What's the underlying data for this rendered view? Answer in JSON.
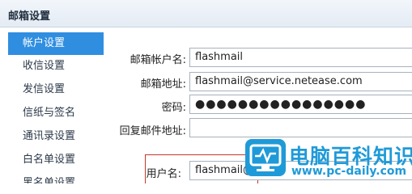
{
  "title": "邮箱设置",
  "sidebar": {
    "items": [
      {
        "label": "帐户设置"
      },
      {
        "label": "收信设置"
      },
      {
        "label": "发信设置"
      },
      {
        "label": "信纸与签名"
      },
      {
        "label": "通讯录设置"
      },
      {
        "label": "白名单设置"
      },
      {
        "label": "黑名单设置"
      }
    ]
  },
  "form": {
    "account_name": {
      "label": "邮箱帐户名:",
      "value": "flashmail"
    },
    "email_address": {
      "label": "邮箱地址:",
      "value": "flashmail@service.netease.com"
    },
    "password": {
      "label": "密码:",
      "value": "●●●●●●●●●●●●●●●●"
    },
    "reply_to": {
      "label": "回复邮件地址:",
      "value": ""
    },
    "username": {
      "label": "用户名:",
      "value": "flashmail@"
    }
  },
  "watermark": {
    "text": "电脑百科知识",
    "url": "www.pc-daily.com",
    "icon": "monitor-icon"
  },
  "colors": {
    "accent": "#2f8ee0",
    "highlight_border": "#c0392b",
    "watermark": "#1f9ad8"
  }
}
